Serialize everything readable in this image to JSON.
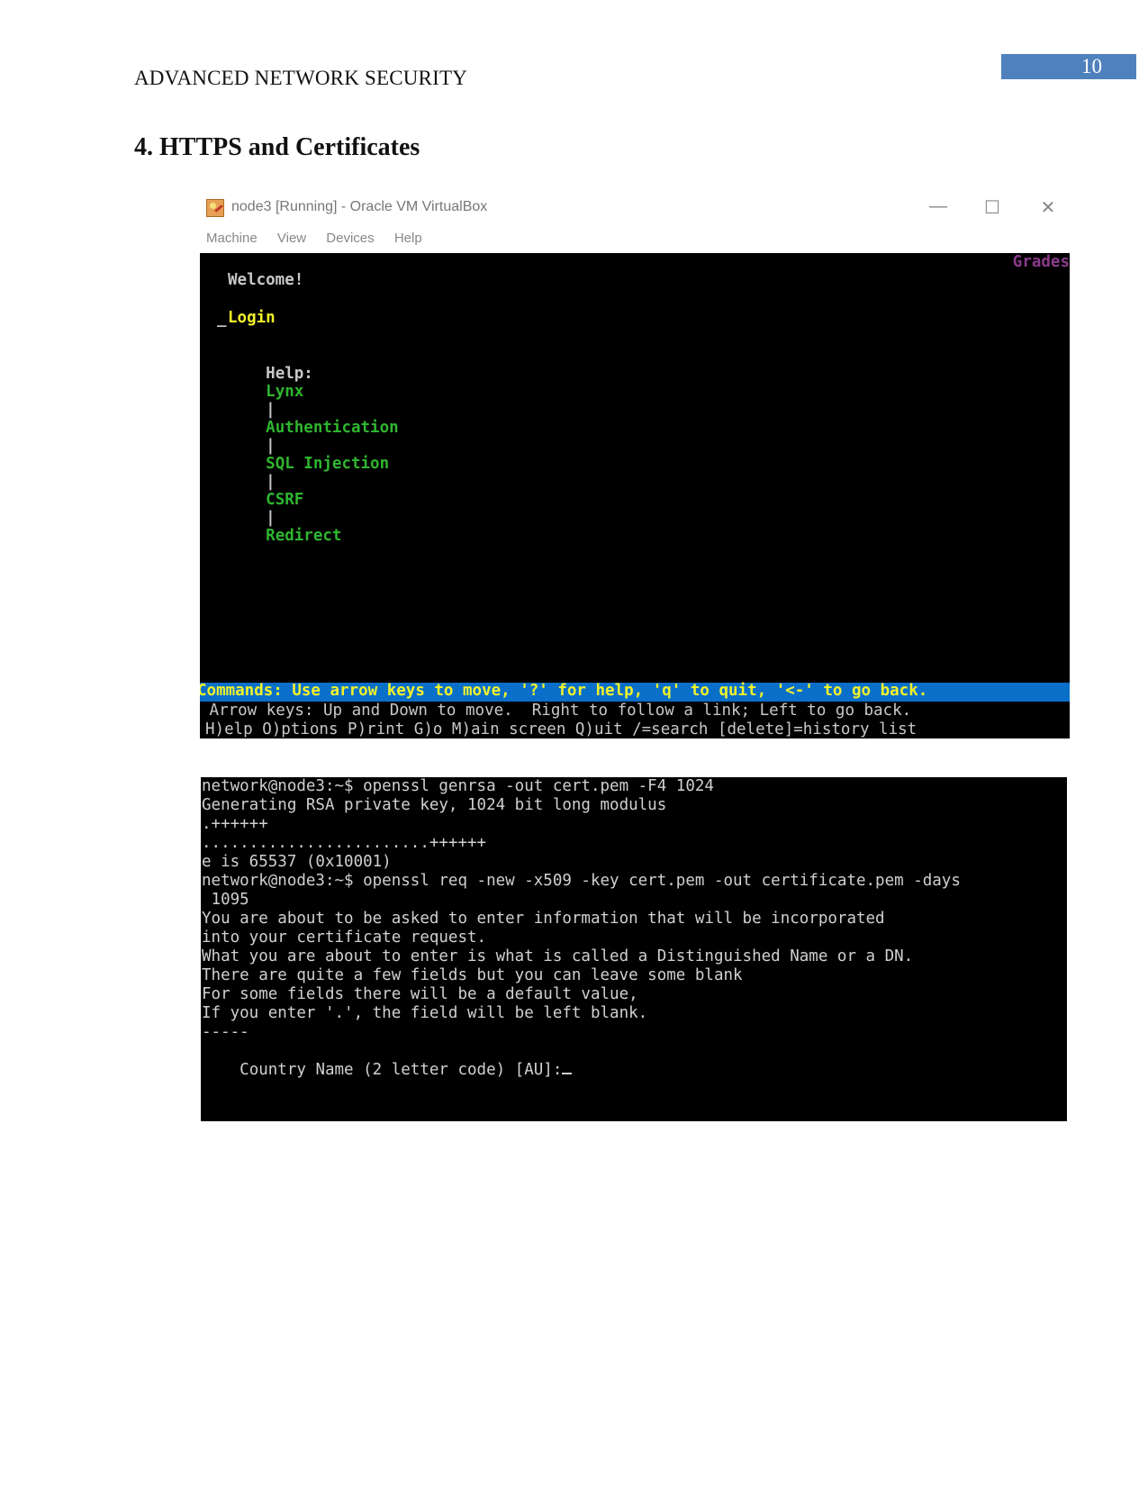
{
  "document": {
    "running_head": "ADVANCED NETWORK SECURITY",
    "page_number": "10",
    "section_title": "4. HTTPS and Certificates",
    "accent_color": "#4f81bd"
  },
  "vbox_window": {
    "title": "node3 [Running] - Oracle VM VirtualBox",
    "controls": {
      "minimize": "—",
      "maximize": "☐",
      "close": "✕"
    },
    "menu": [
      "Machine",
      "View",
      "Devices",
      "Help"
    ]
  },
  "lynx_terminal": {
    "corner_text": "Grades",
    "welcome": "Welcome!",
    "login_link": "Login",
    "help_label": "Help:",
    "help_links": [
      "Lynx",
      "Authentication",
      "SQL Injection",
      "CSRF",
      "Redirect"
    ],
    "separator": "|",
    "commands_bar": "Commands: Use arrow keys to move, '?' for help, 'q' to quit, '<-' to go back.",
    "arrow_keys_line": " Arrow keys: Up and Down to move.  Right to follow a link; Left to go back.",
    "shortcuts_line": "H)elp O)ptions P)rint G)o M)ain screen Q)uit /=search [delete]=history list",
    "colors": {
      "cmdbar_bg": "#0a6fc8",
      "link": "#2fb52f",
      "highlight": "#f2f22a"
    }
  },
  "openssl_terminal": {
    "lines": [
      "network@node3:~$ openssl genrsa -out cert.pem -F4 1024",
      "Generating RSA private key, 1024 bit long modulus",
      ".++++++",
      "........................++++++",
      "e is 65537 (0x10001)",
      "network@node3:~$ openssl req -new -x509 -key cert.pem -out certificate.pem -days",
      " 1095",
      "You are about to be asked to enter information that will be incorporated",
      "into your certificate request.",
      "What you are about to enter is what is called a Distinguished Name or a DN.",
      "There are quite a few fields but you can leave some blank",
      "For some fields there will be a default value,",
      "If you enter '.', the field will be left blank.",
      "-----",
      "Country Name (2 letter code) [AU]:"
    ]
  }
}
